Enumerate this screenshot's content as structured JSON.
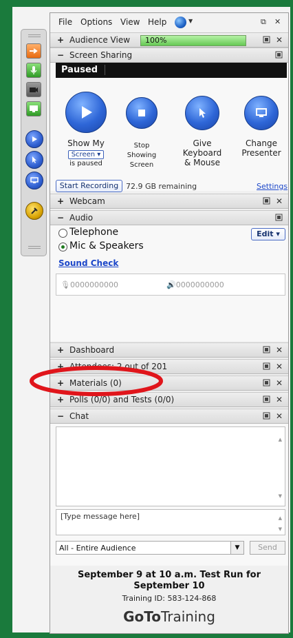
{
  "menu": [
    "File",
    "Options",
    "View",
    "Help"
  ],
  "sections": {
    "audience_view": {
      "title": "Audience View",
      "progress": "100%",
      "progress_value": 1.0
    },
    "screen_sharing": {
      "title": "Screen Sharing",
      "status": "Paused",
      "show_my": {
        "line1": "Show My",
        "dropdown": "Screen",
        "line3": "is paused"
      },
      "stop": {
        "line1": "Stop",
        "line2": "Showing",
        "line3": "Screen"
      },
      "give": {
        "line1": "Give",
        "line2": "Keyboard",
        "line3": "& Mouse"
      },
      "change": {
        "line1": "Change",
        "line2": "Presenter"
      },
      "record_button": "Start Recording",
      "remaining": "72.9 GB remaining",
      "settings_link": "Settings"
    },
    "webcam": {
      "title": "Webcam"
    },
    "audio": {
      "title": "Audio",
      "telephone": "Telephone",
      "mic": "Mic & Speakers",
      "edit_button": "Edit",
      "sound_check": "Sound Check",
      "mic_meter": "0000000000",
      "spk_meter": "0000000000"
    },
    "dashboard": {
      "title": "Dashboard"
    },
    "attendees": {
      "title": "Attendees:",
      "count": "2 out of 201"
    },
    "materials": {
      "title": "Materials (0)"
    },
    "polls": {
      "title": "Polls (0/0) and Tests (0/0)"
    },
    "chat": {
      "title": "Chat",
      "placeholder": "[Type message here]",
      "audience": "All - Entire Audience",
      "send_button": "Send"
    }
  },
  "footer": {
    "line1": "September 9 at 10 a.m. Test Run for",
    "line2": "September 10",
    "training_id": "Training ID: 583-124-868",
    "brand_bold": "GoTo",
    "brand_light": "Training"
  },
  "colors": {
    "accent": "#2e66d7",
    "highlight_ring": "#e0151b",
    "progress": "#7bdc6a"
  }
}
